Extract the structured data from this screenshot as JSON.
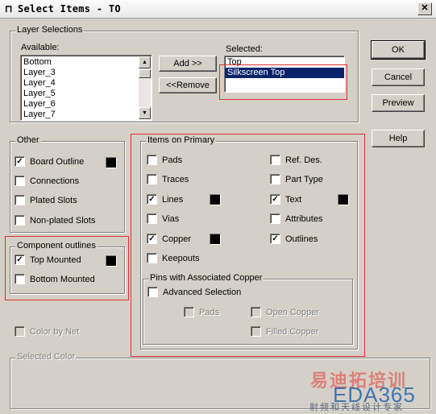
{
  "window": {
    "title": "Select Items - TO",
    "close_glyph": "✕",
    "icon": "window-icon"
  },
  "layer_selections": {
    "label": "Layer Selections",
    "available_label": "Available:",
    "available": [
      "Bottom",
      "Layer_3",
      "Layer_4",
      "Layer_5",
      "Layer_6",
      "Layer_7"
    ],
    "selected_label": "Selected:",
    "selected": [
      "Top",
      "Silkscreen Top"
    ],
    "selected_active_index": 1,
    "add_label": "Add >>",
    "remove_label": "<<Remove"
  },
  "buttons": {
    "ok": "OK",
    "cancel": "Cancel",
    "preview": "Preview",
    "help": "Help"
  },
  "other": {
    "label": "Other",
    "items": [
      {
        "label": "Board Outline",
        "checked": true,
        "color": "#000000"
      },
      {
        "label": "Connections",
        "checked": false
      },
      {
        "label": "Plated Slots",
        "checked": false
      },
      {
        "label": "Non-plated Slots",
        "checked": false
      }
    ]
  },
  "component_outlines": {
    "label": "Component outlines",
    "items": [
      {
        "label": "Top Mounted",
        "checked": true,
        "color": "#000000"
      },
      {
        "label": "Bottom Mounted",
        "checked": false
      }
    ]
  },
  "items_on_primary": {
    "label": "Items on Primary",
    "left": [
      {
        "label": "Pads",
        "checked": false
      },
      {
        "label": "Traces",
        "checked": false
      },
      {
        "label": "Lines",
        "checked": true,
        "color": "#000000"
      },
      {
        "label": "Vias",
        "checked": false
      },
      {
        "label": "Copper",
        "checked": true,
        "color": "#000000"
      },
      {
        "label": "Keepouts",
        "checked": false
      }
    ],
    "right": [
      {
        "label": "Ref. Des.",
        "checked": false
      },
      {
        "label": "Part Type",
        "checked": false
      },
      {
        "label": "Text",
        "checked": true,
        "color": "#000000"
      },
      {
        "label": "Attributes",
        "checked": false
      },
      {
        "label": "Outlines",
        "checked": true
      }
    ]
  },
  "pins_assoc": {
    "label": "Pins with Associated Copper",
    "advanced": "Advanced Selection",
    "pads": "Pads",
    "open_copper": "Open Copper",
    "filled_copper": "Filled Copper"
  },
  "color_by_net": "Color by Net",
  "selected_color_label": "Selected Color",
  "watermark": {
    "line1": "易迪拓培训",
    "line2": "EDA365",
    "line3": "射频和天线设计专家"
  }
}
